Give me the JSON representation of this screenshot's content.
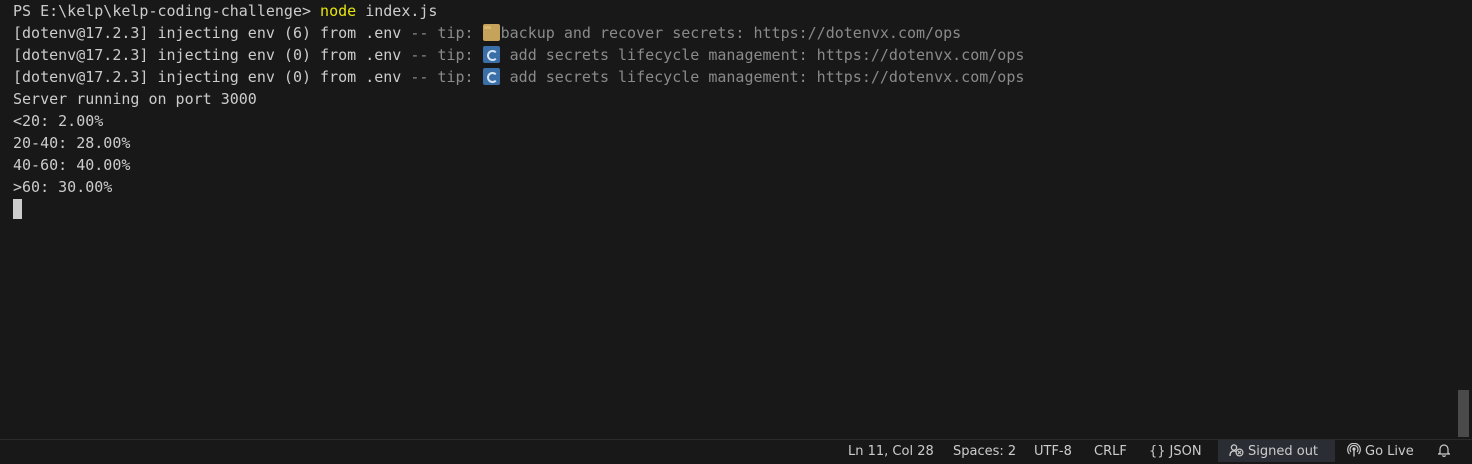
{
  "terminal": {
    "prompt": "PS E:\\kelp\\kelp-coding-challenge> ",
    "command": "node",
    "command_args": " index.js",
    "log_lines": [
      {
        "main": "[dotenv@17.2.3] injecting env (6) from .env ",
        "tip": "-- tip: ",
        "emoji": "folder",
        "message": "backup and recover secrets: https://dotenvx.com/ops"
      },
      {
        "main": "[dotenv@17.2.3] injecting env (0) from .env ",
        "tip": "-- tip: ",
        "emoji": "cycle",
        "message": " add secrets lifecycle management: https://dotenvx.com/ops"
      },
      {
        "main": "[dotenv@17.2.3] injecting env (0) from .env ",
        "tip": "-- tip: ",
        "emoji": "cycle",
        "message": " add secrets lifecycle management: https://dotenvx.com/ops"
      }
    ],
    "output": [
      "Server running on port 3000",
      "<20: 2.00%",
      "20-40: 28.00%",
      "40-60: 40.00%",
      ">60: 30.00%"
    ]
  },
  "statusbar": {
    "position": "Ln 11, Col 28",
    "spaces": "Spaces: 2",
    "encoding": "UTF-8",
    "line_ending": "CRLF",
    "language": "JSON",
    "account": "Signed out",
    "go_live": "Go Live"
  },
  "colors": {
    "background": "#181818",
    "text": "#cccccc",
    "command": "#e5e510",
    "tip": "#8a8a8a"
  }
}
